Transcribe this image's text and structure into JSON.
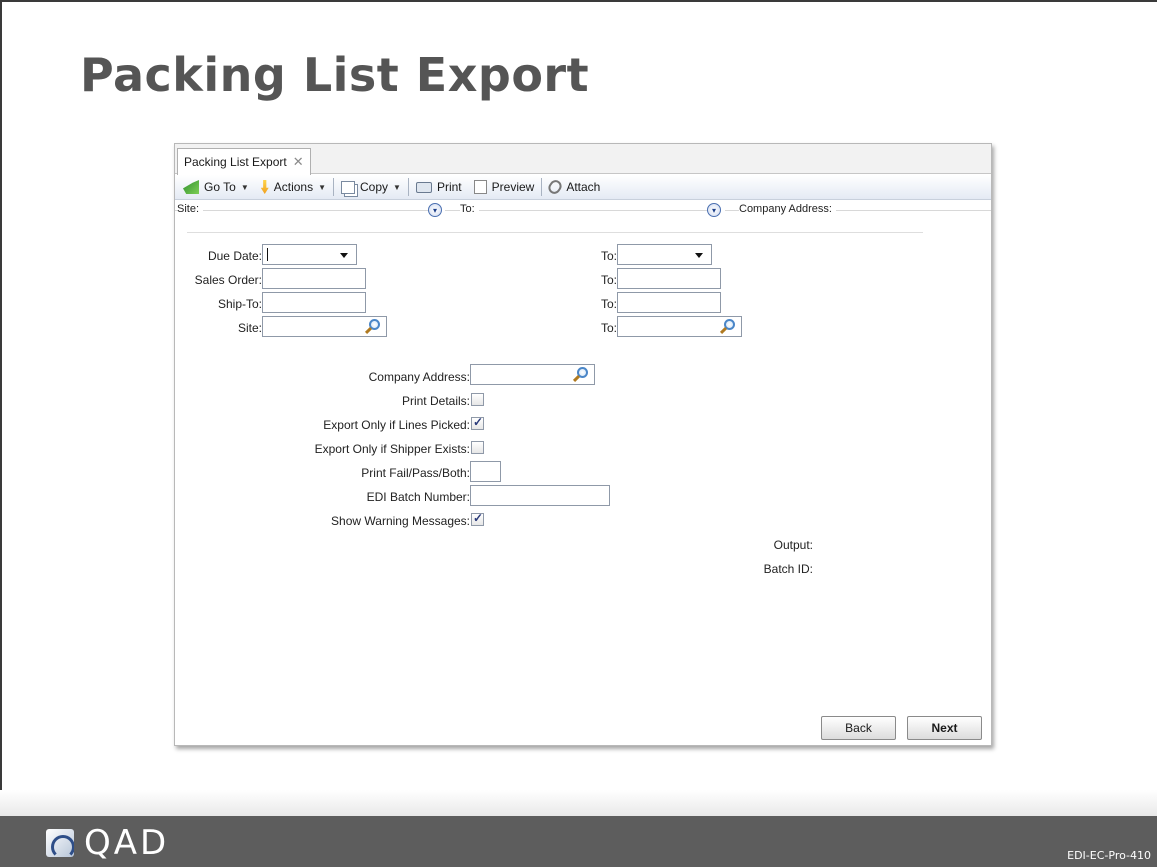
{
  "slide": {
    "title": "Packing List Export",
    "footer_code": "EDI-EC-Pro-410",
    "logo_text": "QAD"
  },
  "window": {
    "tab_label": "Packing List Export",
    "tab_close": "✕",
    "toolbar": {
      "goto": "Go To",
      "actions": "Actions",
      "copy": "Copy",
      "print": "Print",
      "preview": "Preview",
      "attach": "Attach"
    },
    "sections": {
      "site": "Site:",
      "to": "To:",
      "company_address": "Company Address:"
    }
  },
  "form": {
    "due_date_label": "Due Date:",
    "due_date_value": "",
    "due_date_to_label": "To:",
    "due_date_to_value": "",
    "sales_order_label": "Sales Order:",
    "sales_order_value": "",
    "sales_order_to_label": "To:",
    "sales_order_to_value": "",
    "ship_to_label": "Ship-To:",
    "ship_to_value": "",
    "ship_to_to_label": "To:",
    "ship_to_to_value": "",
    "site_label": "Site:",
    "site_value": "",
    "site_to_label": "To:",
    "site_to_value": "",
    "company_address_label": "Company Address:",
    "company_address_value": "",
    "print_details_label": "Print Details:",
    "print_details_checked": false,
    "export_lines_picked_label": "Export Only if Lines Picked:",
    "export_lines_picked_checked": true,
    "export_shipper_exists_label": "Export Only if Shipper Exists:",
    "export_shipper_exists_checked": false,
    "print_fail_pass_label": "Print Fail/Pass/Both:",
    "print_fail_pass_value": "",
    "edi_batch_label": "EDI Batch Number:",
    "edi_batch_value": "",
    "show_warning_label": "Show Warning Messages:",
    "show_warning_checked": true,
    "output_label": "Output:",
    "batch_id_label": "Batch ID:"
  },
  "buttons": {
    "back": "Back",
    "next": "Next"
  }
}
